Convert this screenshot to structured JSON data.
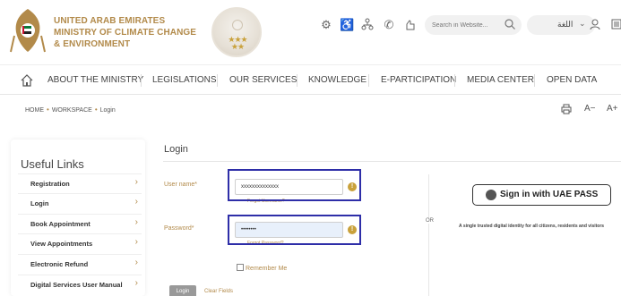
{
  "header": {
    "ministry_lines": [
      "UNITED ARAB EMIRATES",
      "MINISTRY OF CLIMATE CHANGE",
      "& ENVIRONMENT"
    ],
    "search_placeholder": "Search in Website...",
    "language_label": "اللغة",
    "icons": [
      "accessibility-settings-icon",
      "wheelchair-icon",
      "sitemap-icon",
      "phone-icon",
      "hand-icon",
      "search-icon",
      "chevron-down-icon",
      "user-icon",
      "menu-icon"
    ]
  },
  "nav": {
    "items": [
      "ABOUT THE MINISTRY",
      "LEGISLATIONS",
      "OUR SERVICES",
      "KNOWLEDGE",
      "E-PARTICIPATION",
      "MEDIA CENTER",
      "OPEN DATA"
    ]
  },
  "breadcrumb": {
    "items": [
      "HOME",
      "WORKSPACE",
      "Login"
    ]
  },
  "tools": {
    "decrease_font": "A−",
    "increase_font": "A+"
  },
  "sidebar": {
    "title": "Useful Links",
    "items": [
      "Registration",
      "Login",
      "Book Appointment",
      "View Appointments",
      "Electronic Refund",
      "Digital Services User Manual"
    ]
  },
  "login": {
    "title": "Login",
    "username_label": "User name*",
    "username_value": "xxxxxxxxxxxxxx",
    "forgot_username": "Forgot Username?",
    "password_label": "Password*",
    "password_value": "••••••••",
    "forgot_password": "Forgot Password?",
    "remember_me": "Remember Me",
    "login_button": "Login",
    "clear_fields": "Clear Fields",
    "or_label": "OR",
    "uaepass_button": "Sign in with UAE PASS",
    "uaepass_subtitle": "A single trusted digital identity for all citizens, residents and visitors"
  },
  "colors": {
    "gold": "#b28a4a",
    "highlight": "#2e2ea8"
  }
}
